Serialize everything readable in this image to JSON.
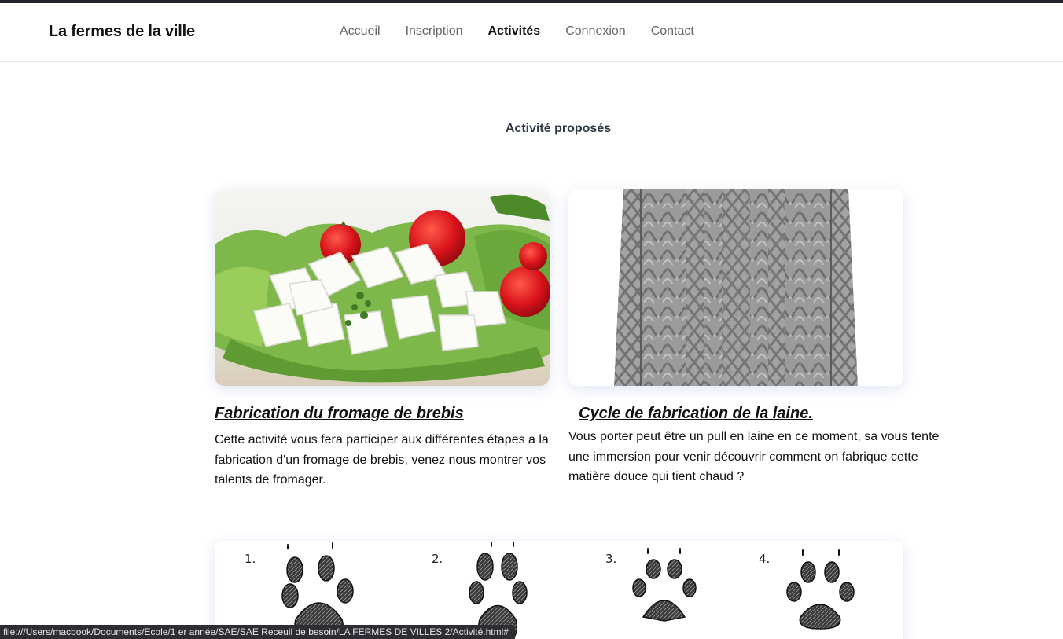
{
  "header": {
    "brand": "La fermes de la ville",
    "nav": [
      {
        "label": "Accueil",
        "active": false
      },
      {
        "label": "Inscription",
        "active": false
      },
      {
        "label": "Activités",
        "active": true
      },
      {
        "label": "Connexion",
        "active": false
      },
      {
        "label": "Contact",
        "active": false
      }
    ]
  },
  "main": {
    "title": "Activité proposés",
    "cards": [
      {
        "title": "Fabrication du fromage de brebis",
        "text": "Cette activité vous fera participer aux différentes étapes a la fabrication d'un fromage de brebis, venez nous montrer vos talents de fromager.",
        "image": "feta-cheese-salad-photo"
      },
      {
        "title": "Cycle de fabrication de la laine.",
        "text": "Vous porter peut être un pull en laine en ce moment, sa vous tente une immersion pour venir découvrir comment on fabrique cette matière douce qui tient chaud ?",
        "image": "grey-wool-sweater-photo"
      },
      {
        "image": "animal-paw-prints-drawing",
        "paw_labels": [
          "1.",
          "2.",
          "3.",
          "4."
        ]
      }
    ]
  },
  "status_bar": {
    "url": "file:///Users/macbook/Documents/Ecole/1 er année/SAE/SAE Receuil de besoin/LA FERMES DE VILLES 2/Activité.html#"
  },
  "colors": {
    "topbar": "#24242a",
    "nav_inactive": "#666666",
    "nav_active": "#111111",
    "section_title": "#2f3847"
  }
}
